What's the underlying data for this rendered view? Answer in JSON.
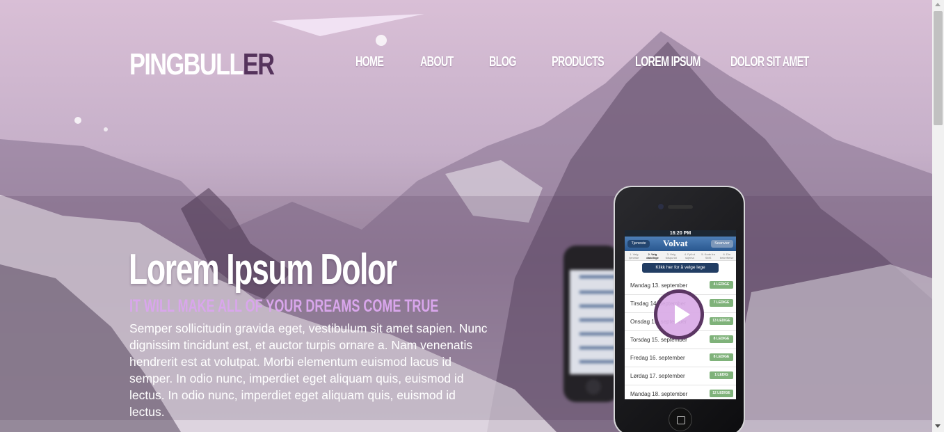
{
  "logo": {
    "text_main": "PINGBULL",
    "text_accent": "ER"
  },
  "nav": {
    "items": [
      {
        "label": "HOME"
      },
      {
        "label": "ABOUT"
      },
      {
        "label": "BLOG"
      },
      {
        "label": "PRODUCTS"
      },
      {
        "label": "LOREM IPSUM"
      },
      {
        "label": "DOLOR SIT AMET"
      }
    ]
  },
  "hero": {
    "title": "Lorem Ipsum Dolor",
    "subtitle": "IT WILL MAKE ALL OF YOUR DREAMS COME TRUE",
    "body": "Semper sollicitudin gravida eget, vestibulum sit amet sapien. Nunc dignissim tincidunt est, et auctor turpis ornare a. Nam venenatis hendrerit est at volutpat. Morbi elementum euismod lacus id semper. In odio nunc, imperdiet eget aliquam quis, euismod id lectus. In odio nunc, imperdiet eget aliquam quis, euismod id lectus."
  },
  "phone": {
    "status_time": "16:20 PM",
    "back_button": "Tjeneste",
    "app_title": "Volvat",
    "right_button": "Seanvier",
    "steps": [
      "1. Velg tjeneste",
      "2. Velg dato/lege",
      "3. Velg tidspunkt",
      "4. Fyll ut skjema",
      "5. Kode fra SMS",
      "6. Din bekreftelse"
    ],
    "pick_label": "Klikk her for å velge lege",
    "days": [
      {
        "date": "Mandag 13. september",
        "count": "4 LEDIGE"
      },
      {
        "date": "Tirsdag 14. september",
        "count": "7 LEDIGE"
      },
      {
        "date": "Onsdag 15. september",
        "count": "13 LEDIGE"
      },
      {
        "date": "Torsdag 15. september",
        "count": "8 LEDIGE"
      },
      {
        "date": "Fredag 16. september",
        "count": "8 LEDIGE"
      },
      {
        "date": "Lørdag 17. september",
        "count": "1 LEDIG"
      },
      {
        "date": "Mandag 18. september",
        "count": "12 LEDIGE"
      }
    ]
  },
  "colors": {
    "logo_accent": "#55335c",
    "subtitle": "#d9a6ec",
    "play_button": "#d9aae6"
  },
  "icons": [
    "play-icon",
    "home-button-icon"
  ]
}
